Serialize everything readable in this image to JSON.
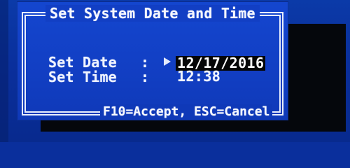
{
  "dialog": {
    "title": "Set System Date and Time",
    "fields": {
      "date_label": "Set Date",
      "time_label": "Set Time",
      "colon": ":",
      "date_value": "12/17/2016",
      "time_value": "12:38"
    },
    "footer": "F10=Accept, ESC=Cancel"
  },
  "colors": {
    "screen_blue": "#0a2f9c",
    "dialog_blue": "#123fc4",
    "frame_white": "#e9eefc",
    "selection_black": "#050607",
    "shadow_black": "#05070c"
  },
  "icons": {
    "cursor": "right-triangle-cursor-icon"
  }
}
